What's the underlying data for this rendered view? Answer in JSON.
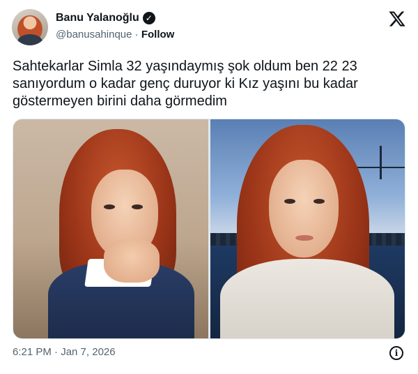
{
  "author": {
    "display_name": "Banu Yalanoğlu",
    "handle": "@banusahinque",
    "separator": " · ",
    "follow_label": "Follow"
  },
  "icons": {
    "verified": "verified-badge-icon",
    "logo": "x-logo-icon",
    "info": "info-icon"
  },
  "tweet": {
    "text": "Sahtekarlar Simla 32 yaşındaymış şok oldum ben 22 23\nsanıyordum o kadar genç duruyor ki Kız yaşını bu kadar\ngöstermeyen birini daha görmedim",
    "timestamp": "6:21 PM · Jan 7, 2026"
  },
  "colors": {
    "text": "#0f1419",
    "secondary": "#536471",
    "border": "#e1e8ed"
  }
}
